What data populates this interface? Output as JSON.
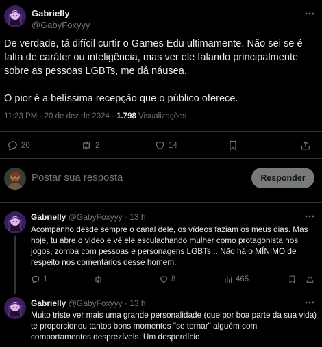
{
  "main_tweet": {
    "author_name": "Gabrielly",
    "author_handle": "@GabyFoxyyy",
    "paragraph1": "De verdade, tá difícil curtir o Games Edu ultimamente. Não sei se é falta de caráter ou inteligência, mas ver ele falando principalmente sobre as pessoas LGBTs, me dá náusea.",
    "paragraph2": "O pior é a belíssima recepção que o público oferece.",
    "timestamp": "11:23 PM · 20 de dez de 2024 · ",
    "views_count": "1.798",
    "views_label": " Visualizações",
    "replies_count": "20",
    "retweets_count": "2",
    "likes_count": "14"
  },
  "composer": {
    "placeholder": "Postar sua resposta",
    "button_label": "Responder"
  },
  "replies": [
    {
      "author_name": "Gabrielly",
      "author_handle": "@GabyFoxyyy",
      "time": "· 13 h",
      "text": "Acompanho desde sempre o canal dele, os vídeos faziam os meus dias. Mas hoje, tu abre o vídeo e vê ele esculachando mulher como protagonista nos jogos, zomba com pessoas e personagens LGBTs... Não há o MÍNIMO de respeito nos comentários desse homem.",
      "replies_count": "1",
      "retweets_count": "",
      "likes_count": "8",
      "views_count": "465"
    },
    {
      "author_name": "Gabrielly",
      "author_handle": "@GabyFoxyyy",
      "time": "· 13 h",
      "text": "Muito triste ver mais uma grande personalidade (que por boa parte da sua vida) te proporcionou tantos bons momentos \"se tornar\" alguém com comportamentos desprezíveis. Um desperdício"
    }
  ],
  "colors": {
    "background": "#000000",
    "text": "#e7e9ea",
    "muted": "#71767b",
    "divider": "#2f3336",
    "reply_button": "#787a7a"
  }
}
